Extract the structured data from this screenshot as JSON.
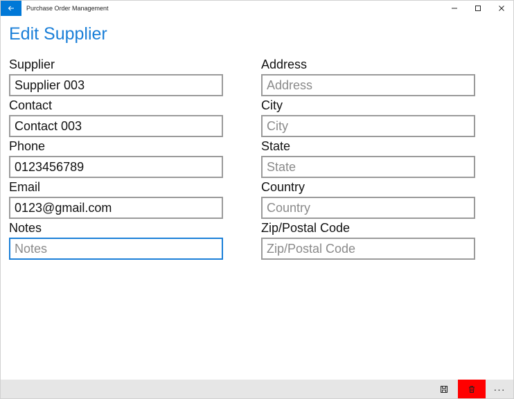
{
  "window": {
    "app_title": "Purchase Order Management"
  },
  "page": {
    "title": "Edit Supplier"
  },
  "left_fields": [
    {
      "label": "Supplier",
      "value": "Supplier 003",
      "placeholder": ""
    },
    {
      "label": "Contact",
      "value": "Contact 003",
      "placeholder": ""
    },
    {
      "label": "Phone",
      "value": "0123456789",
      "placeholder": ""
    },
    {
      "label": "Email",
      "value": "0123@gmail.com",
      "placeholder": ""
    },
    {
      "label": "Notes",
      "value": "",
      "placeholder": "Notes"
    }
  ],
  "right_fields": [
    {
      "label": "Address",
      "value": "",
      "placeholder": "Address"
    },
    {
      "label": "City",
      "value": "",
      "placeholder": "City"
    },
    {
      "label": "State",
      "value": "",
      "placeholder": "State"
    },
    {
      "label": "Country",
      "value": "",
      "placeholder": "Country"
    },
    {
      "label": "Zip/Postal Code",
      "value": "",
      "placeholder": "Zip/Postal Code"
    }
  ],
  "cmdbar": {
    "more_label": "···"
  },
  "icons": {
    "back": "back-arrow-icon",
    "minimize": "minimize-icon",
    "maximize": "maximize-icon",
    "close": "close-icon",
    "save": "save-icon",
    "delete": "delete-icon"
  },
  "colors": {
    "accent": "#0078d7",
    "title": "#1a7fd8",
    "delete_bg": "#ff0000",
    "cmdbar_bg": "#e6e6e6"
  }
}
